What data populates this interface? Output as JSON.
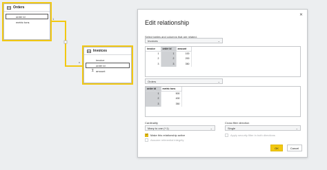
{
  "orders_table": {
    "title": "Orders",
    "fields": [
      "order id",
      "metric tons"
    ]
  },
  "invoices_table": {
    "title": "Invoices",
    "fields": [
      "invoice",
      "order id",
      "amount"
    ]
  },
  "dialog": {
    "title": "Edit relationship",
    "subtitle": "Select tables and columns that are related.",
    "table1_select": "Invoices",
    "table1_preview": {
      "headers": [
        "invoice",
        "order id",
        "amount"
      ],
      "rows": [
        [
          "1",
          "1",
          "100"
        ],
        [
          "2",
          "2",
          "200"
        ],
        [
          "3",
          "3",
          "350"
        ]
      ]
    },
    "table2_select": "Orders",
    "table2_preview": {
      "headers": [
        "order id",
        "metric tons"
      ],
      "rows": [
        [
          "1",
          "500"
        ],
        [
          "2",
          "400"
        ],
        [
          "3",
          "350"
        ]
      ]
    },
    "cardinality_label": "Cardinality",
    "cardinality_value": "Many to one (*:1)",
    "cross_filter_label": "Cross filter direction",
    "cross_filter_value": "Single",
    "make_active_label": "Make this relationship active",
    "make_active_checked": true,
    "security_filter_label": "Apply security filter in both directions",
    "referential_integrity_label": "Assume referential integrity",
    "ok_label": "OK",
    "cancel_label": "Cancel",
    "close_icon": "close-icon"
  },
  "colors": {
    "accent": "#f2c811",
    "background": "#eceef0",
    "border": "#b9bcc0"
  }
}
